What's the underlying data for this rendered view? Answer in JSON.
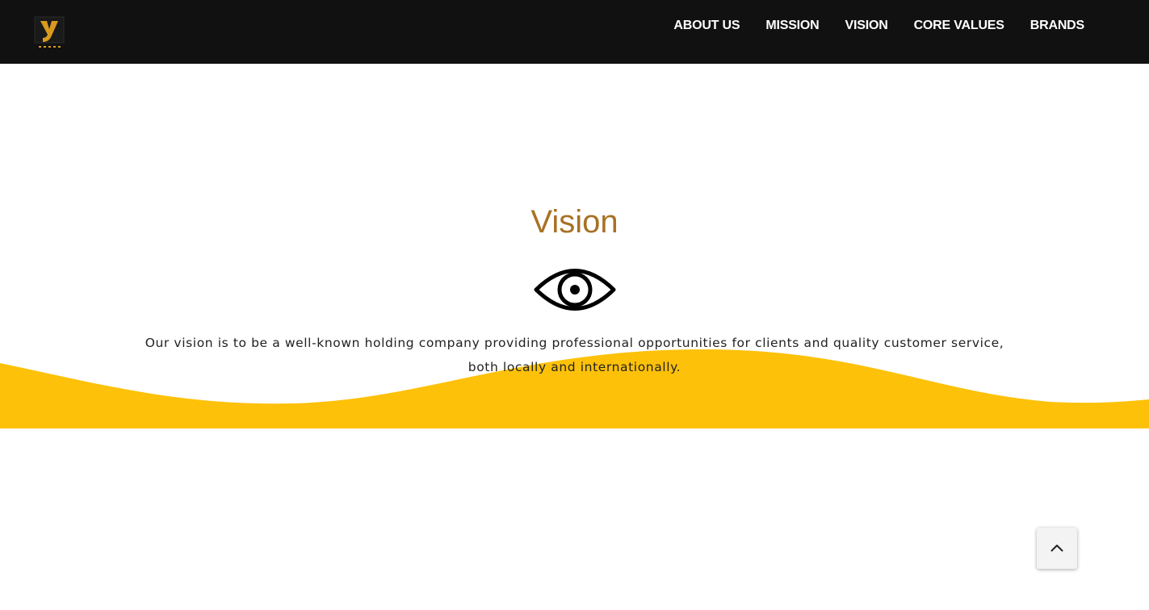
{
  "header": {
    "logo_icon": "y-letter-logo-icon",
    "nav": [
      {
        "label": "ABOUT US"
      },
      {
        "label": "MISSION"
      },
      {
        "label": "VISION"
      },
      {
        "label": "CORE VALUES"
      },
      {
        "label": "BRANDS"
      }
    ]
  },
  "vision": {
    "title": "Vision",
    "icon": "eye-icon",
    "text": "Our vision is to be a well-known holding company providing professional opportunities for clients and quality customer service, both locally and internationally."
  },
  "scroll_top": {
    "icon": "chevron-up-icon"
  },
  "colors": {
    "header_bg": "#111111",
    "accent_gold": "#a87124",
    "wave_yellow": "#fdc109",
    "logo_gold": "#d99a1e"
  }
}
